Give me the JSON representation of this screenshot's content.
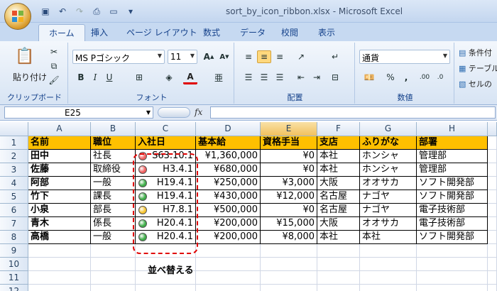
{
  "window": {
    "title": "sort_by_icon_ribbon.xlsx - Microsoft Excel"
  },
  "tabs": [
    "ホーム",
    "挿入",
    "ページ レイアウト",
    "数式",
    "データ",
    "校閲",
    "表示"
  ],
  "ribbon": {
    "paste_label": "貼り付け",
    "clipboard_label": "クリップボード",
    "font_label": "フォント",
    "align_label": "配置",
    "number_label": "数値",
    "font_name": "MS Pゴシック",
    "font_size": "11",
    "number_format": "通貨",
    "styles_items": [
      "条件付",
      "テーブル",
      "セルの"
    ]
  },
  "formula_bar": {
    "namebox": "E25",
    "fx": "fx"
  },
  "columns": [
    "A",
    "B",
    "C",
    "D",
    "E",
    "F",
    "G",
    "H"
  ],
  "rows": [
    "1",
    "2",
    "3",
    "4",
    "5",
    "6",
    "7",
    "8",
    "9",
    "10",
    "11",
    "12"
  ],
  "table": {
    "headers": [
      "名前",
      "職位",
      "入社日",
      "基本給",
      "資格手当",
      "支店",
      "ふりがな",
      "部署"
    ],
    "rows": [
      [
        "田中",
        "社長",
        "S63.10.1",
        "¥1,360,000",
        "¥0",
        "本社",
        "ホンシャ",
        "管理部"
      ],
      [
        "佐藤",
        "取締役",
        "H3.4.1",
        "¥680,000",
        "¥0",
        "本社",
        "ホンシャ",
        "管理部"
      ],
      [
        "阿部",
        "一般",
        "H19.4.1",
        "¥250,000",
        "¥3,000",
        "大阪",
        "オオサカ",
        "ソフト開発部"
      ],
      [
        "竹下",
        "課長",
        "H19.4.1",
        "¥430,000",
        "¥12,000",
        "名古屋",
        "ナゴヤ",
        "ソフト開発部"
      ],
      [
        "小泉",
        "部長",
        "H7.8.1",
        "¥500,000",
        "¥0",
        "名古屋",
        "ナゴヤ",
        "電子技術部"
      ],
      [
        "青木",
        "係長",
        "H20.4.1",
        "¥200,000",
        "¥15,000",
        "大阪",
        "オオサカ",
        "電子技術部"
      ],
      [
        "高橋",
        "一般",
        "H20.4.1",
        "¥200,000",
        "¥8,000",
        "本社",
        "本社",
        "ソフト開発部"
      ]
    ],
    "icon_colors": [
      "#f06060",
      "#f06060",
      "#3fae49",
      "#3fae49",
      "#f7c531",
      "#3fae49",
      "#3fae49"
    ]
  },
  "annotation": "並べ替える"
}
